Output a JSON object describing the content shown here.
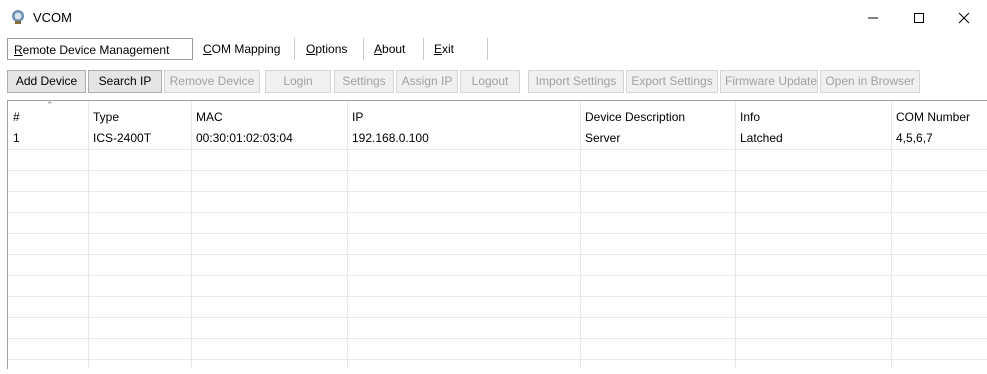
{
  "window": {
    "title": "VCOM",
    "icon": "vcom-app-icon"
  },
  "menu": {
    "tabs": [
      {
        "label": "Remote Device Management",
        "accel": "R",
        "active": true
      },
      {
        "label": "COM Mapping",
        "accel": "C"
      },
      {
        "label": "Options",
        "accel": "O"
      },
      {
        "label": "About",
        "accel": "A"
      },
      {
        "label": "Exit",
        "accel": "E"
      }
    ]
  },
  "toolbar": {
    "buttons": [
      {
        "label": "Add Device",
        "enabled": true
      },
      {
        "label": "Search IP",
        "enabled": true
      },
      {
        "label": "Remove Device",
        "enabled": false
      },
      {
        "label": "Login",
        "enabled": false
      },
      {
        "label": "Settings",
        "enabled": false
      },
      {
        "label": "Assign IP",
        "enabled": false
      },
      {
        "label": "Logout",
        "enabled": false
      },
      {
        "label": "Import Settings",
        "enabled": false
      },
      {
        "label": "Export Settings",
        "enabled": false
      },
      {
        "label": "Firmware Update",
        "enabled": false
      },
      {
        "label": "Open in Browser",
        "enabled": false
      }
    ]
  },
  "table": {
    "columns": [
      "#",
      "Type",
      "MAC",
      "IP",
      "Device Description",
      "Info",
      "COM Number"
    ],
    "sorted_column": "#",
    "rows": [
      [
        "1",
        "ICS-2400T",
        "00:30:01:02:03:04",
        "192.168.0.100",
        "Server",
        "Latched",
        "4,5,6,7"
      ]
    ]
  }
}
